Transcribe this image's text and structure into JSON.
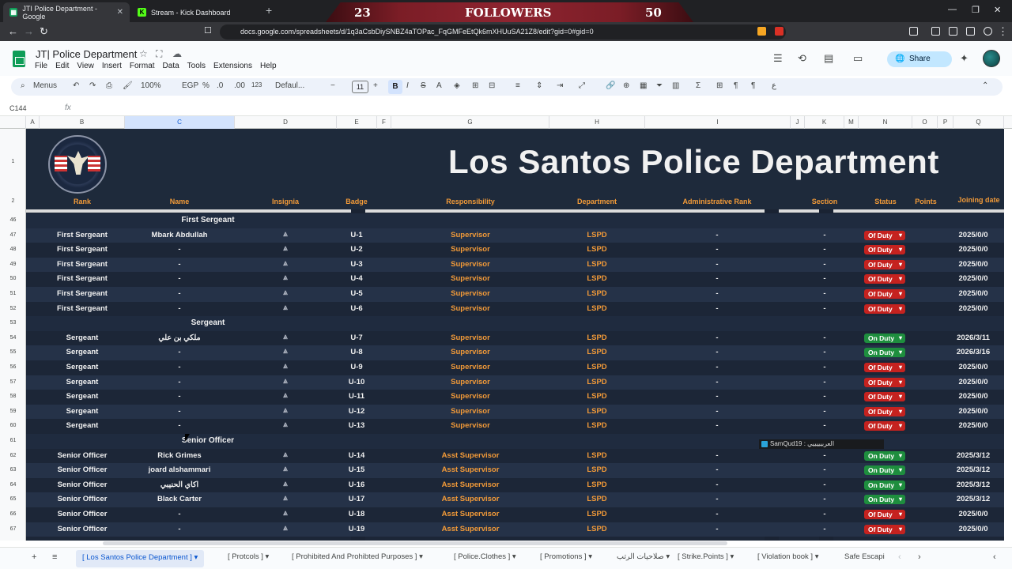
{
  "browser": {
    "tabs": [
      {
        "title": "JTI Police Department - Google",
        "active": true
      },
      {
        "title": "Stream - Kick Dashboard",
        "active": false
      }
    ],
    "url": "docs.google.com/spreadsheets/d/1q3aCsbDiySNBZ4aTOPac_FqGMFeEtQk6mXHUuSA21Z8/edit?gid=0#gid=0",
    "overlay": {
      "left_count": "23",
      "label": "FOLLOWERS",
      "right_count": "50"
    }
  },
  "sheets": {
    "title": "JT| Police Department",
    "menu": [
      "File",
      "Edit",
      "View",
      "Insert",
      "Format",
      "Data",
      "Tools",
      "Extensions",
      "Help"
    ],
    "share_label": "Share",
    "toolbar": {
      "menus": "Menus",
      "zoom": "100%",
      "currency": "EGP",
      "percent": "%",
      "dec_less": ".0",
      "dec_more": ".00",
      "num": "123",
      "font": "Defaul...",
      "size": "11",
      "bold": "B"
    },
    "name_box": "C144",
    "fx": "fx"
  },
  "columns": [
    "A",
    "B",
    "C",
    "D",
    "E",
    "F",
    "G",
    "H",
    "I",
    "J",
    "K",
    "M",
    "N",
    "O",
    "P",
    "Q"
  ],
  "banner_title": "Los Santos Police Department",
  "header_row": {
    "row_num": "2",
    "rank": "Rank",
    "name": "Name",
    "insignia": "Insignia",
    "badge": "Badge",
    "responsibility": "Responsibility",
    "department": "Department",
    "admin_rank": "Administrative Rank",
    "section": "Section",
    "status": "Status",
    "points": "Points",
    "joining": "Joining date"
  },
  "rows": [
    {
      "n": "46",
      "group": "First Sergeant"
    },
    {
      "n": "47",
      "rank": "First Sergeant",
      "name": "Mbark Abdullah",
      "badge": "U-1",
      "resp": "Supervisor",
      "dept": "LSPD",
      "adm": "-",
      "sec": "-",
      "status": "Of Duty",
      "st": "off",
      "date": "2025/0/0"
    },
    {
      "n": "48",
      "rank": "First Sergeant",
      "name": "-",
      "badge": "U-2",
      "resp": "Supervisor",
      "dept": "LSPD",
      "adm": "-",
      "sec": "-",
      "status": "Of Duty",
      "st": "off",
      "date": "2025/0/0"
    },
    {
      "n": "49",
      "rank": "First Sergeant",
      "name": "-",
      "badge": "U-3",
      "resp": "Supervisor",
      "dept": "LSPD",
      "adm": "-",
      "sec": "-",
      "status": "Of Duty",
      "st": "off",
      "date": "2025/0/0"
    },
    {
      "n": "50",
      "rank": "First Sergeant",
      "name": "-",
      "badge": "U-4",
      "resp": "Supervisor",
      "dept": "LSPD",
      "adm": "-",
      "sec": "-",
      "status": "Of Duty",
      "st": "off",
      "date": "2025/0/0"
    },
    {
      "n": "51",
      "rank": "First Sergeant",
      "name": "-",
      "badge": "U-5",
      "resp": "Supervisor",
      "dept": "LSPD",
      "adm": "-",
      "sec": "-",
      "status": "Of Duty",
      "st": "off",
      "date": "2025/0/0"
    },
    {
      "n": "52",
      "rank": "First Sergeant",
      "name": "-",
      "badge": "U-6",
      "resp": "Supervisor",
      "dept": "LSPD",
      "adm": "-",
      "sec": "-",
      "status": "Of Duty",
      "st": "off",
      "date": "2025/0/0"
    },
    {
      "n": "53",
      "group": "Sergeant"
    },
    {
      "n": "54",
      "rank": "Sergeant",
      "name": "ملكي بن علي",
      "badge": "U-7",
      "resp": "Supervisor",
      "dept": "LSPD",
      "adm": "-",
      "sec": "-",
      "status": "On Duty",
      "st": "on",
      "date": "2026/3/11"
    },
    {
      "n": "55",
      "rank": "Sergeant",
      "name": "-",
      "badge": "U-8",
      "resp": "Supervisor",
      "dept": "LSPD",
      "adm": "-",
      "sec": "-",
      "status": "On Duty",
      "st": "on",
      "date": "2026/3/16"
    },
    {
      "n": "56",
      "rank": "Sergeant",
      "name": "-",
      "badge": "U-9",
      "resp": "Supervisor",
      "dept": "LSPD",
      "adm": "-",
      "sec": "-",
      "status": "Of Duty",
      "st": "off",
      "date": "2025/0/0"
    },
    {
      "n": "57",
      "rank": "Sergeant",
      "name": "-",
      "badge": "U-10",
      "resp": "Supervisor",
      "dept": "LSPD",
      "adm": "-",
      "sec": "-",
      "status": "Of Duty",
      "st": "off",
      "date": "2025/0/0"
    },
    {
      "n": "58",
      "rank": "Sergeant",
      "name": "-",
      "badge": "U-11",
      "resp": "Supervisor",
      "dept": "LSPD",
      "adm": "-",
      "sec": "-",
      "status": "Of Duty",
      "st": "off",
      "date": "2025/0/0"
    },
    {
      "n": "59",
      "rank": "Sergeant",
      "name": "-",
      "badge": "U-12",
      "resp": "Supervisor",
      "dept": "LSPD",
      "adm": "-",
      "sec": "-",
      "status": "Of Duty",
      "st": "off",
      "date": "2025/0/0"
    },
    {
      "n": "60",
      "rank": "Sergeant",
      "name": "-",
      "badge": "U-13",
      "resp": "Supervisor",
      "dept": "LSPD",
      "adm": "-",
      "sec": "-",
      "status": "Of Duty",
      "st": "off",
      "date": "2025/0/0"
    },
    {
      "n": "61",
      "group": "Senior Officer"
    },
    {
      "n": "62",
      "rank": "Senior Officer",
      "name": "Rick Grimes",
      "badge": "U-14",
      "resp": "Asst Supervisor",
      "dept": "LSPD",
      "adm": "-",
      "sec": "-",
      "status": "On Duty",
      "st": "on",
      "date": "2025/3/12"
    },
    {
      "n": "63",
      "rank": "Senior Officer",
      "name": "joard alshammari",
      "badge": "U-15",
      "resp": "Asst Supervisor",
      "dept": "LSPD",
      "adm": "-",
      "sec": "-",
      "status": "On Duty",
      "st": "on",
      "date": "2025/3/12"
    },
    {
      "n": "64",
      "rank": "Senior Officer",
      "name": "اكاي الحنيبي",
      "badge": "U-16",
      "resp": "Asst Supervisor",
      "dept": "LSPD",
      "adm": "-",
      "sec": "-",
      "status": "On Duty",
      "st": "on",
      "date": "2025/3/12"
    },
    {
      "n": "65",
      "rank": "Senior Officer",
      "name": "Black Carter",
      "badge": "U-17",
      "resp": "Asst Supervisor",
      "dept": "LSPD",
      "adm": "-",
      "sec": "-",
      "status": "On Duty",
      "st": "on",
      "date": "2025/3/12"
    },
    {
      "n": "66",
      "rank": "Senior Officer",
      "name": "-",
      "badge": "U-18",
      "resp": "Asst Supervisor",
      "dept": "LSPD",
      "adm": "-",
      "sec": "-",
      "status": "Of Duty",
      "st": "off",
      "date": "2025/0/0"
    },
    {
      "n": "67",
      "rank": "Senior Officer",
      "name": "-",
      "badge": "U-19",
      "resp": "Asst Supervisor",
      "dept": "LSPD",
      "adm": "-",
      "sec": "-",
      "status": "Of Duty",
      "st": "off",
      "date": "2025/0/0"
    }
  ],
  "chat_overlay": "SamQud19 : العربيييييي",
  "sheet_tabs": [
    "[ Los Santos Police Department ]",
    "[ Protcols ]",
    "[ Prohibited And Prohibted Purposes ]",
    "[ Police.Clothes ]",
    "[ Promotions ]",
    "صلاحيات الرتب",
    "[ Strike.Points ]",
    "[ Violation book ]",
    "Safe Escapi"
  ],
  "colors": {
    "accent": "#f29a38",
    "on_duty": "#1e8e3e",
    "off_duty": "#c5221f",
    "bg": "#1c2637"
  }
}
